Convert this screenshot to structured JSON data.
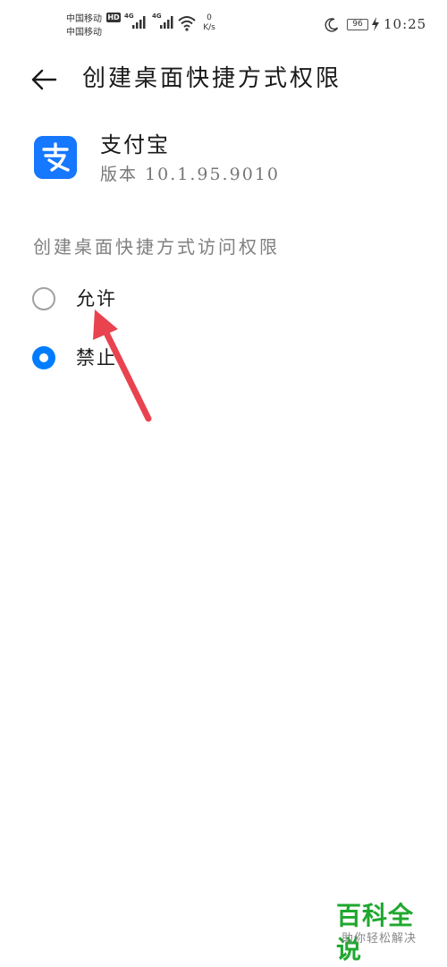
{
  "status_bar": {
    "carrier_1": "中国移动",
    "carrier_2": "中国移动",
    "hd_badge": "HD",
    "network_1": "4G",
    "network_2": "4G",
    "speed_value": "0",
    "speed_unit": "K/s",
    "battery_level": "96",
    "time": "10:25",
    "icons": [
      "signal-icon",
      "wifi-icon",
      "moon-icon",
      "battery-icon",
      "charging-icon"
    ]
  },
  "header": {
    "back_icon": "arrow-left-icon",
    "title": "创建桌面快捷方式权限"
  },
  "app": {
    "name": "支付宝",
    "version": "版本 10.1.95.9010",
    "icon_glyph": "支",
    "icon_color": "#1677ff"
  },
  "permission": {
    "section_label": "创建桌面快捷方式访问权限",
    "options": [
      {
        "label": "允许",
        "selected": false
      },
      {
        "label": "禁止",
        "selected": true
      }
    ],
    "accent_color": "#007dff"
  },
  "annotation": {
    "type": "arrow",
    "color": "#e8434f"
  },
  "watermark": {
    "title": "百科全说",
    "subtitle": "助你轻松解决"
  }
}
